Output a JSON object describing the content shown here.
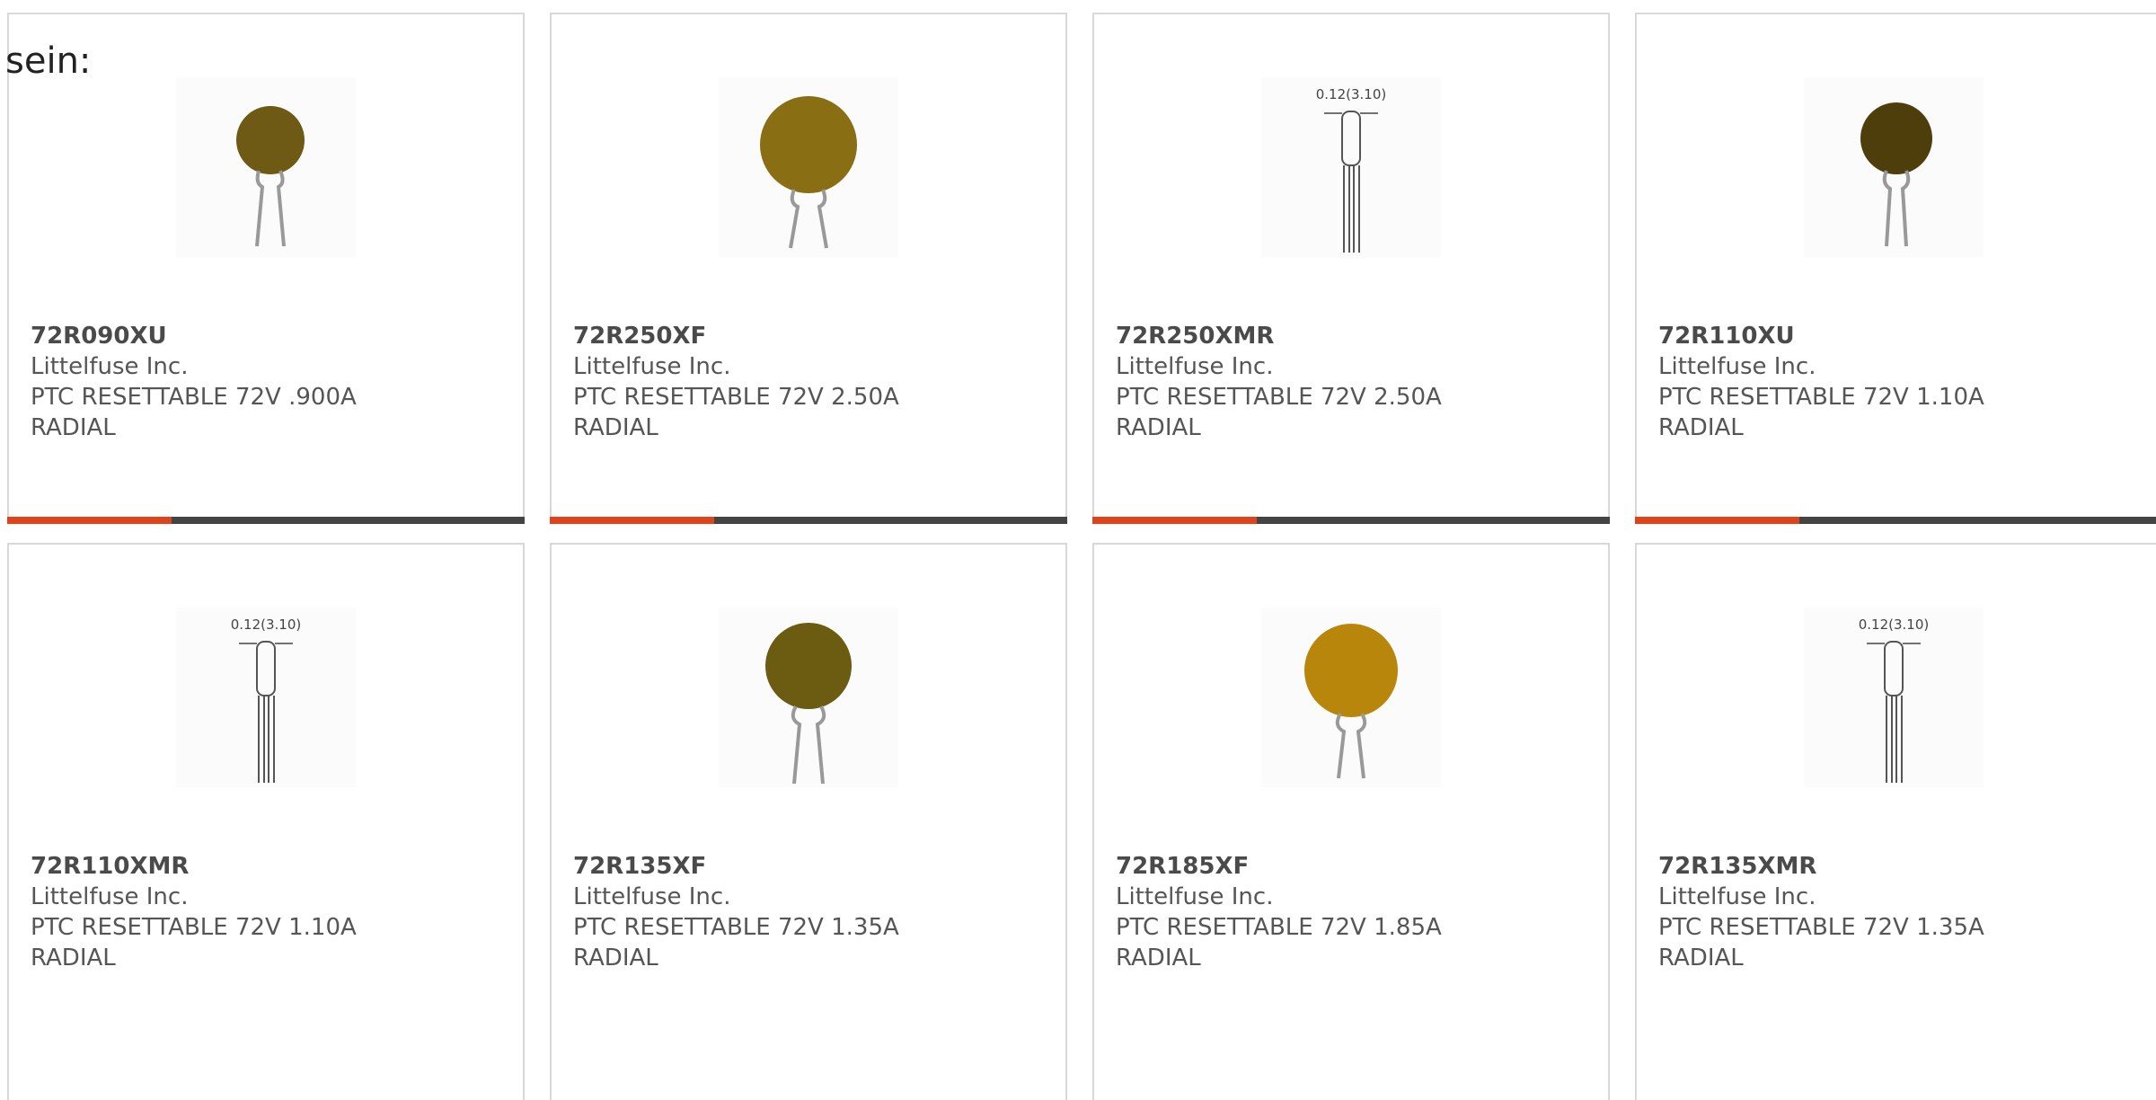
{
  "heading": "sein:",
  "colors": {
    "accent": "#e0421a",
    "bar": "#444444",
    "border": "#d8d8d8",
    "disc_dark": "#5a4a10",
    "disc_olive": "#6b5c12",
    "disc_amber": "#b8860b"
  },
  "dim_label": "0.12(3.10)",
  "products": [
    {
      "part": "72R090XU",
      "manufacturer": "Littelfuse Inc.",
      "desc1": "PTC RESETTABLE 72V .900A",
      "desc2": "RADIAL",
      "image": "disc-thermistor-small"
    },
    {
      "part": "72R250XF",
      "manufacturer": "Littelfuse Inc.",
      "desc1": "PTC RESETTABLE 72V 2.50A",
      "desc2": "RADIAL",
      "image": "disc-thermistor-large"
    },
    {
      "part": "72R250XMR",
      "manufacturer": "Littelfuse Inc.",
      "desc1": "PTC RESETTABLE 72V 2.50A",
      "desc2": "RADIAL",
      "image": "side-view-drawing"
    },
    {
      "part": "72R110XU",
      "manufacturer": "Littelfuse Inc.",
      "desc1": "PTC RESETTABLE 72V 1.10A",
      "desc2": "RADIAL",
      "image": "disc-thermistor-dark"
    },
    {
      "part": "72R110XMR",
      "manufacturer": "Littelfuse Inc.",
      "desc1": "PTC RESETTABLE 72V 1.10A",
      "desc2": "RADIAL",
      "image": "side-view-drawing"
    },
    {
      "part": "72R135XF",
      "manufacturer": "Littelfuse Inc.",
      "desc1": "PTC RESETTABLE 72V 1.35A",
      "desc2": "RADIAL",
      "image": "disc-thermistor-olive"
    },
    {
      "part": "72R185XF",
      "manufacturer": "Littelfuse Inc.",
      "desc1": "PTC RESETTABLE 72V 1.85A",
      "desc2": "RADIAL",
      "image": "disc-thermistor-amber"
    },
    {
      "part": "72R135XMR",
      "manufacturer": "Littelfuse Inc.",
      "desc1": "PTC RESETTABLE 72V 1.35A",
      "desc2": "RADIAL",
      "image": "side-view-drawing"
    }
  ]
}
